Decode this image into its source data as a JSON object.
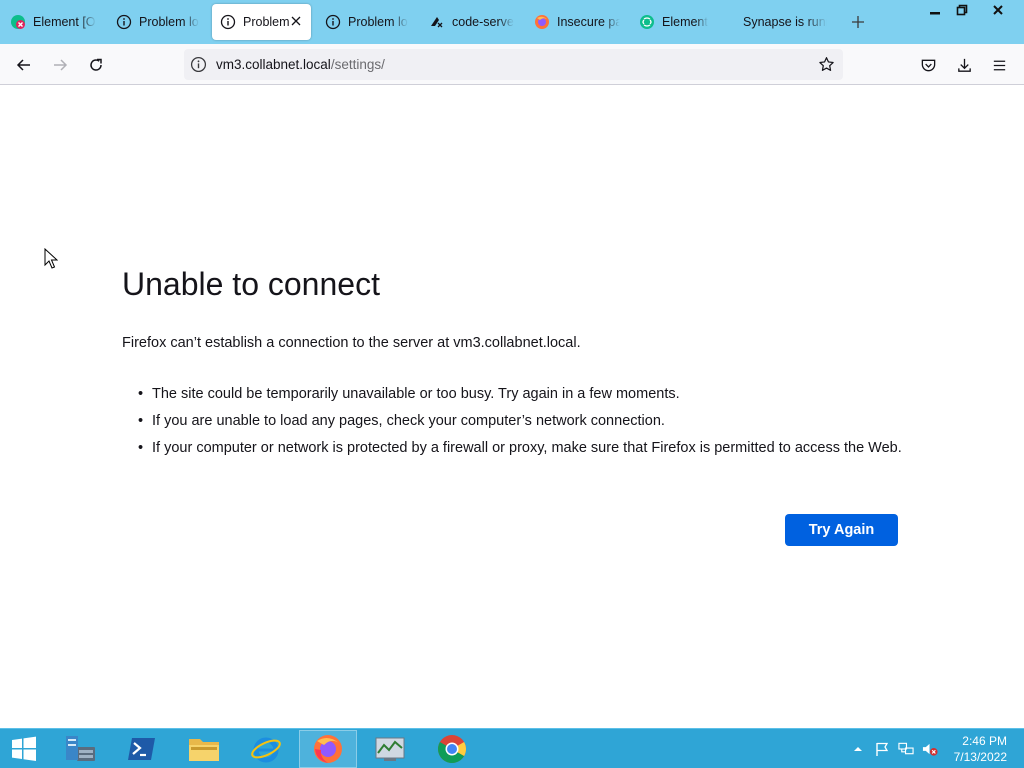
{
  "tabs": [
    {
      "title": "Element [O",
      "icon": "element-notification-icon",
      "active": false
    },
    {
      "title": "Problem lo",
      "icon": "info-icon",
      "active": false
    },
    {
      "title": "Problem",
      "icon": "info-icon",
      "active": true
    },
    {
      "title": "Problem lo",
      "icon": "info-icon",
      "active": false
    },
    {
      "title": "code-serve",
      "icon": "code-server-icon",
      "active": false
    },
    {
      "title": "Insecure pa",
      "icon": "firefox-icon",
      "active": false
    },
    {
      "title": "Element",
      "icon": "element-icon",
      "active": false
    },
    {
      "title": "Synapse is runn",
      "icon": "",
      "active": false
    }
  ],
  "address": {
    "host": "vm3.collabnet.local",
    "path": "/settings/"
  },
  "error": {
    "title": "Unable to connect",
    "description": "Firefox can’t establish a connection to the server at vm3.collabnet.local.",
    "items": [
      "The site could be temporarily unavailable or too busy. Try again in a few moments.",
      "If you are unable to load any pages, check your computer’s network connection.",
      "If your computer or network is protected by a firewall or proxy, make sure that Firefox is permitted to access the Web."
    ],
    "button": "Try Again"
  },
  "taskbar": {
    "apps": [
      "server-manager-icon",
      "powershell-icon",
      "file-explorer-icon",
      "internet-explorer-icon",
      "firefox-icon",
      "task-manager-icon",
      "chrome-icon"
    ],
    "time": "2:46 PM",
    "date": "7/13/2022"
  },
  "colors": {
    "tabstrip": "#7fd0f0",
    "accent_button": "#0061e0",
    "taskbar": "#2fa5d6"
  }
}
